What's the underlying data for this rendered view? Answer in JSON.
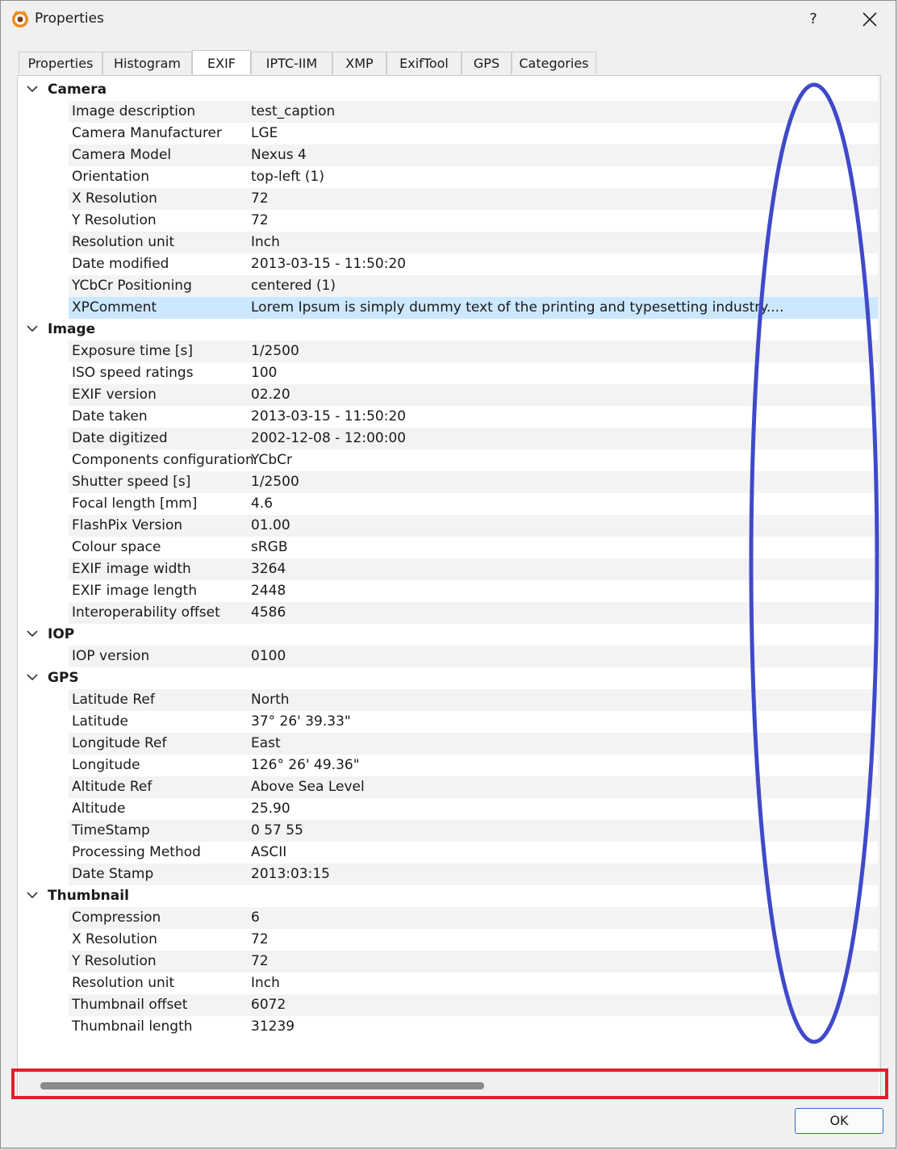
{
  "window": {
    "title": "Properties",
    "help_label": "?",
    "close_label": "✕"
  },
  "tabs": [
    "Properties",
    "Histogram",
    "EXIF",
    "IPTC-IIM",
    "XMP",
    "ExifTool",
    "GPS",
    "Categories"
  ],
  "active_tab": "EXIF",
  "groups": [
    {
      "name": "Camera",
      "rows": [
        [
          "Image description",
          "test_caption"
        ],
        [
          "Camera Manufacturer",
          "LGE"
        ],
        [
          "Camera Model",
          "Nexus 4"
        ],
        [
          "Orientation",
          "top-left (1)"
        ],
        [
          "X Resolution",
          "72"
        ],
        [
          "Y Resolution",
          "72"
        ],
        [
          "Resolution unit",
          "Inch"
        ],
        [
          "Date modified",
          "2013-03-15 - 11:50:20"
        ],
        [
          "YCbCr Positioning",
          "centered (1)"
        ],
        [
          "XPComment",
          "Lorem Ipsum is simply dummy text of the printing and typesetting industry...."
        ]
      ]
    },
    {
      "name": "Image",
      "rows": [
        [
          "Exposure time [s]",
          "1/2500"
        ],
        [
          "ISO speed ratings",
          "100"
        ],
        [
          "EXIF version",
          "02.20"
        ],
        [
          "Date taken",
          "2013-03-15 - 11:50:20"
        ],
        [
          "Date digitized",
          "2002-12-08 - 12:00:00"
        ],
        [
          "Components configuration",
          "YCbCr"
        ],
        [
          "Shutter speed [s]",
          "1/2500"
        ],
        [
          "Focal length [mm]",
          "4.6"
        ],
        [
          "FlashPix Version",
          "01.00"
        ],
        [
          "Colour space",
          "sRGB"
        ],
        [
          "EXIF image width",
          "3264"
        ],
        [
          "EXIF image length",
          "2448"
        ],
        [
          "Interoperability offset",
          "4586"
        ]
      ]
    },
    {
      "name": "IOP",
      "rows": [
        [
          "IOP version",
          "0100"
        ]
      ]
    },
    {
      "name": "GPS",
      "rows": [
        [
          "Latitude Ref",
          "North"
        ],
        [
          "Latitude",
          "37° 26' 39.33\""
        ],
        [
          "Longitude Ref",
          "East"
        ],
        [
          "Longitude",
          "126° 26' 49.36\""
        ],
        [
          "Altitude Ref",
          "Above Sea Level"
        ],
        [
          "Altitude",
          "25.90"
        ],
        [
          "TimeStamp",
          "0 57 55"
        ],
        [
          "Processing Method",
          "ASCII"
        ],
        [
          "Date Stamp",
          "2013:03:15"
        ]
      ]
    },
    {
      "name": "Thumbnail",
      "rows": [
        [
          "Compression",
          "6"
        ],
        [
          "X Resolution",
          "72"
        ],
        [
          "Y Resolution",
          "72"
        ],
        [
          "Resolution unit",
          "Inch"
        ],
        [
          "Thumbnail offset",
          "6072"
        ],
        [
          "Thumbnail length",
          "31239"
        ]
      ]
    }
  ],
  "selected_key": "XPComment",
  "ok_label": "OK",
  "colors": {
    "annotation_ellipse": "#4049c9",
    "annotation_box": "#e0202a",
    "selection": "#cce8ff"
  }
}
